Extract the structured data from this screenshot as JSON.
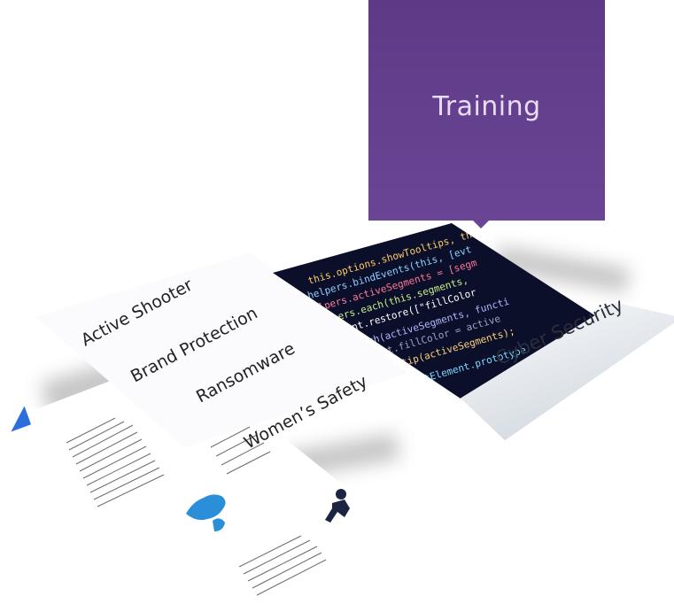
{
  "callout": {
    "title": "Training"
  },
  "topics": [
    "Active Shooter",
    "Brand Protection",
    "Ransomware",
    "Women’s Safety"
  ],
  "cyber": {
    "label": "Cyber Security"
  },
  "colors": {
    "callout_purple": "#62408c",
    "code_background": "#0b0f2a",
    "brochure_blue": "#2a6fdb"
  },
  "icons": [
    "world-map-icon",
    "running-person-icon"
  ]
}
